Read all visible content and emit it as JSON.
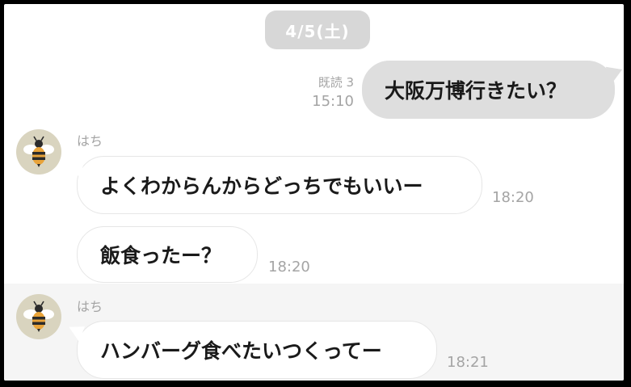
{
  "date_separator": "4/5(土)",
  "messages": [
    {
      "direction": "outgoing",
      "text": "大阪万博行きたい？",
      "read_receipt": "既読 3",
      "time": "15:10"
    },
    {
      "direction": "incoming",
      "sender": "はち",
      "text": "よくわからんからどっちでもいいー",
      "time": "18:20"
    },
    {
      "direction": "incoming",
      "sender": "",
      "text": "飯食ったー？",
      "time": "18:20"
    },
    {
      "direction": "incoming",
      "sender": "はち",
      "text": "ハンバーグ食べたいつくってー",
      "time": "18:21"
    }
  ],
  "colors": {
    "outgoing_bubble": "#dedede",
    "incoming_bubble": "#ffffff",
    "date_pill": "#d7d7d7",
    "meta_text": "#a4a4a4",
    "avatar_bg": "#d9d4bf",
    "highlight_row": "#f5f5f5"
  },
  "avatar_icon": "bee-icon"
}
